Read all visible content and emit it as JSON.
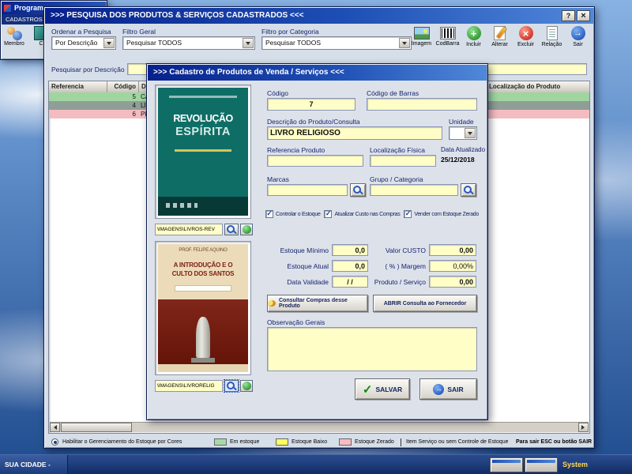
{
  "desktop": {
    "taskbar": {
      "left_label": "SUA CIDADE -",
      "right_label": "System"
    }
  },
  "back_window": {
    "title": "Programa",
    "menu_label": "CADASTROS",
    "icon1_label": "Membro",
    "icon2_label": "C"
  },
  "main_window": {
    "title": ">>>  PESQUISA DOS PRODUTOS & SERVIÇOS CADASTRADOS  <<<",
    "filters": {
      "ordenar_label": "Ordenar a Pesquisa",
      "ordenar_value": "Por Descrição",
      "geral_label": "Filtro Geral",
      "geral_value": "Pesquisar TODOS",
      "categoria_label": "Filtro por Categoria",
      "categoria_value": "Pesquisar TODOS"
    },
    "toolbar": {
      "imagem": "Imagem",
      "codbarra": "CodBarra",
      "incluir": "Incluir",
      "alterar": "Alterar",
      "excluir": "Excluir",
      "relacao": "Relação",
      "sair": "Sair"
    },
    "search_label": "Pesquisar por Descrição",
    "search_value": "",
    "table": {
      "col_referencia": "Referencia",
      "col_codigo": "Código",
      "col_descricao": "Descrição do Produto",
      "col_localizacao": "Localização do Produto",
      "rows": [
        {
          "codigo": "5",
          "descricao": "CADERN"
        },
        {
          "codigo": "4",
          "descricao": "LIVROS"
        },
        {
          "codigo": "6",
          "descricao": "PRESEN"
        }
      ]
    },
    "legend": {
      "gerenciamento": "Habilitar o Gerenciamento do Estoque por Cores",
      "em_estoque": "Em estoque",
      "estoque_baixo": "Estoque Baixo",
      "estoque_zerado": "Estoque Zerado",
      "item_servico": "Item Serviço ou sem Controle de Estoque",
      "sair_hint": "Para sair ESC ou botão SAIR"
    }
  },
  "dialog": {
    "title": ">>>  Cadastro de Produtos de Venda / Serviços  <<<",
    "image1": {
      "cover_title1": "REVOLUÇÃO",
      "cover_title2": "ESPÍRITA",
      "path": "\\IMAGENS\\LIVROS-REV"
    },
    "image2": {
      "cover_author": "PROF. FELIPE AQUINO",
      "cover_title1": "A INTRODUÇÃO E O",
      "cover_title2": "CULTO DOS SANTOS",
      "path": "\\IMAGENS\\LIVRORELIG"
    },
    "fields": {
      "codigo_label": "Código",
      "codigo_value": "7",
      "barras_label": "Código de Barras",
      "barras_value": "",
      "descricao_label": "Descrição do Produto/Consulta",
      "descricao_value": "LIVRO RELIGIOSO",
      "unidade_label": "Unidade",
      "unidade_value": "",
      "referencia_label": "Referencia Produto",
      "referencia_value": "",
      "local_label": "Localização Física",
      "local_value": "",
      "data_atualizado_label": "Data Atualizado",
      "data_atualizado_value": "25/12/2018",
      "marcas_label": "Marcas",
      "marcas_value": "",
      "grupo_label": "Grupo / Categoria",
      "grupo_value": "",
      "cb1": "Controlar o Estoque",
      "cb2": "Atualizar Custo nas Compras",
      "cb3": "Vender com Estoque Zerado",
      "estoque_min_label": "Estoque Mínimo",
      "estoque_min_value": "0,0",
      "estoque_atual_label": "Estoque Atual",
      "estoque_atual_value": "0,0",
      "validade_label": "Data Validade",
      "validade_value": "/ /",
      "custo_label": "Valor CUSTO",
      "custo_value": "0,00",
      "margem_label": "( % ) Margem",
      "margem_value": "0,00%",
      "produto_label": "Produto / Serviço",
      "produto_value": "0,00",
      "obs_label": "Observação Gerais",
      "obs_value": ""
    },
    "buttons": {
      "consultar": "Consultar Compras desse Produto",
      "abrir": "ABRIR Consulta ao Fornecedor",
      "salvar": "SALVAR",
      "sair": "SAIR"
    }
  }
}
